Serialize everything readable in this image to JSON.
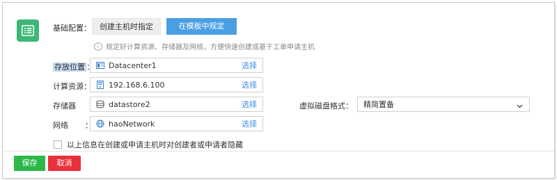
{
  "basic_config": {
    "label": "基础配置：",
    "options": [
      "创建主机时指定",
      "在模板中规定"
    ],
    "selected": "在模板中规定"
  },
  "hint": "规定好计算资源、存储器及网络，方便快速创建或基于工单申请主机",
  "fields": {
    "location": {
      "label": "存放位置",
      "colon": "：",
      "value": "Datacenter1",
      "pick": "选择",
      "icon": "datacenter-icon"
    },
    "compute": {
      "label": "计算资源：",
      "value": "192.168.6.100",
      "pick": "选择",
      "icon": "server-icon"
    },
    "storage": {
      "label": "存储器",
      "colon": "：",
      "value": "datastore2",
      "pick": "选择",
      "icon": "datastore-icon"
    },
    "network": {
      "label": "网络",
      "colon": "：",
      "value": "haoNetwork",
      "pick": "选择",
      "icon": "network-icon"
    }
  },
  "disk_format": {
    "label": "虚拟磁盘格式：",
    "value": "精简置备"
  },
  "hide_checkbox": {
    "label": "以上信息在创建或申请主机时对创建者或申请者隐藏",
    "checked": false
  },
  "buttons": {
    "save": "保存",
    "cancel": "取消"
  },
  "colors": {
    "accent": "#4a9fe3",
    "save": "#2db84a",
    "cancel": "#e8313b",
    "icon_bg": "#3db874",
    "link": "#3a8ee6"
  }
}
